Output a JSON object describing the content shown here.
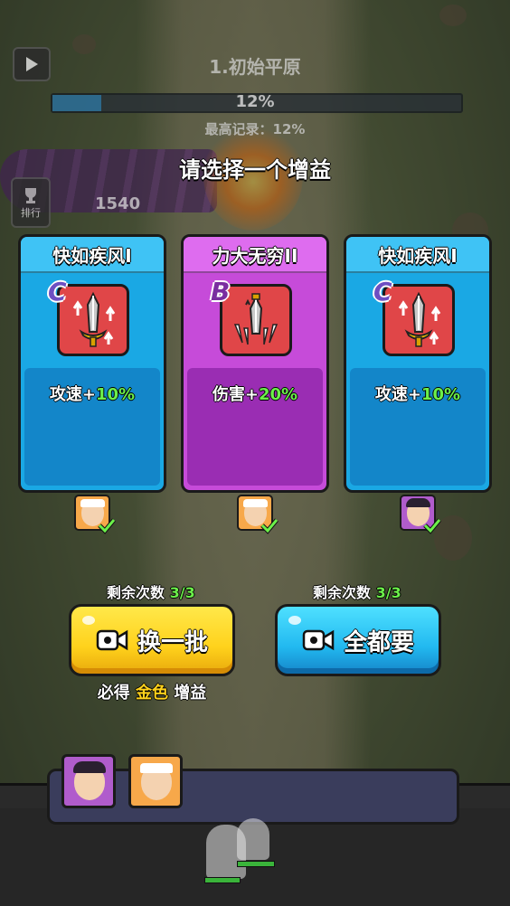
{
  "colors": {
    "accent_green": "#6cf04a",
    "gold": "#ffd21c",
    "blue_card": "#1aa8e4",
    "purple_card": "#c64bd9"
  },
  "hud": {
    "play_icon": "play-icon",
    "level_title": "1.初始平原",
    "progress": {
      "percent": 12,
      "text": "12%"
    },
    "record": "最高记录：12%",
    "rank_label": "排行",
    "score": "1540"
  },
  "prompt": "请选择一个增益",
  "cards": [
    {
      "title": "快如疾风I",
      "grade": "C",
      "icon": "sword-speed-icon",
      "stat": "攻速+",
      "value": "10%",
      "rarity": "blue"
    },
    {
      "title": "力大无穷II",
      "grade": "B",
      "icon": "sword-power-icon",
      "stat": "伤害+",
      "value": "20%",
      "rarity": "purple"
    },
    {
      "title": "快如疾风I",
      "grade": "C",
      "icon": "sword-speed-icon",
      "stat": "攻速+",
      "value": "10%",
      "rarity": "blue"
    }
  ],
  "actions": {
    "refresh": {
      "counter_label": "剩余次数",
      "counter_value": "3/3",
      "label": "换一批",
      "icon": "video-icon"
    },
    "take_all": {
      "counter_label": "剩余次数",
      "counter_value": "3/3",
      "label": "全都要",
      "icon": "video-icon"
    },
    "guarantee": {
      "prefix": "必得",
      "highlight": "金色",
      "suffix": "增益"
    }
  }
}
